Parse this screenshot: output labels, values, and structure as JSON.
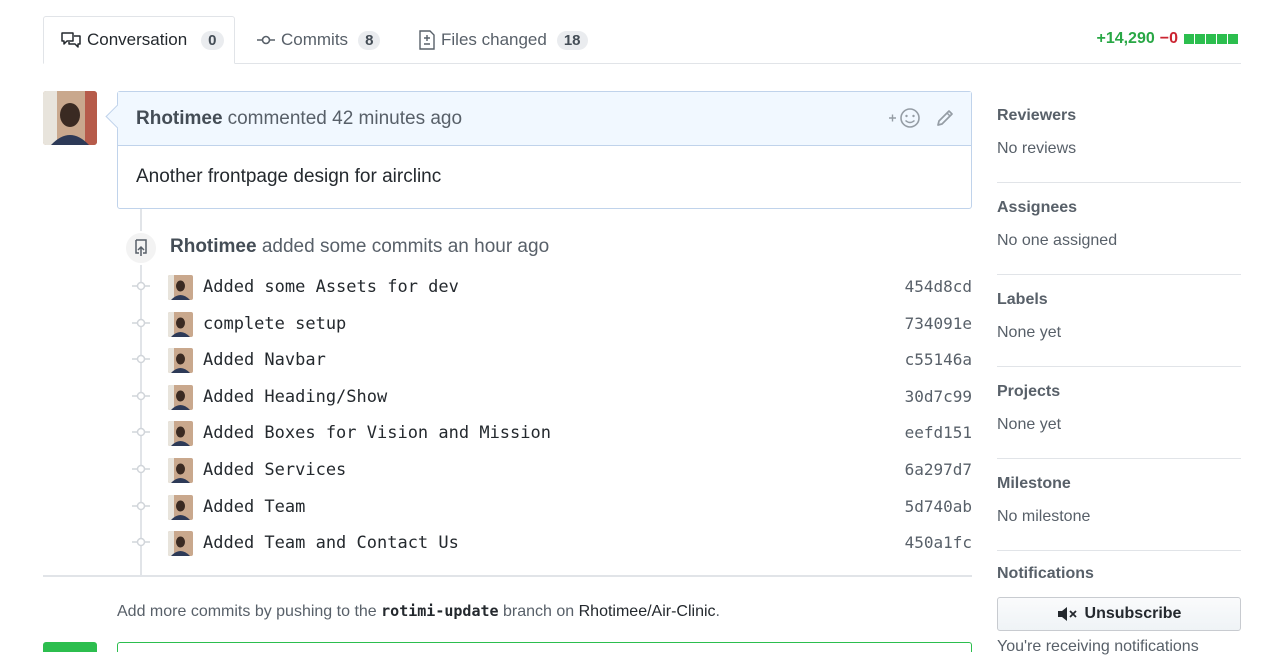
{
  "tabs": [
    {
      "label": "Conversation",
      "count": "0",
      "icon": "comment-discussion-icon"
    },
    {
      "label": "Commits",
      "count": "8",
      "icon": "git-commit-icon"
    },
    {
      "label": "Files changed",
      "count": "18",
      "icon": "file-diff-icon"
    }
  ],
  "diffstat": {
    "additions": "+14,290",
    "deletions": "−0",
    "blocks_added": 5,
    "blocks_total": 5
  },
  "comment": {
    "author": "Rhotimee",
    "action": "commented 42 minutes ago",
    "body": "Another frontpage design for airclinc"
  },
  "commit_event": {
    "author": "Rhotimee",
    "action": "added some commits an hour ago"
  },
  "commits": [
    {
      "message": "Added some Assets for dev",
      "sha": "454d8cd"
    },
    {
      "message": "complete setup",
      "sha": "734091e"
    },
    {
      "message": "Added Navbar",
      "sha": "c55146a"
    },
    {
      "message": "Added Heading/Show",
      "sha": "30d7c99"
    },
    {
      "message": "Added Boxes for Vision and Mission",
      "sha": "eefd151"
    },
    {
      "message": "Added Services",
      "sha": "6a297d7"
    },
    {
      "message": "Added Team",
      "sha": "5d740ab"
    },
    {
      "message": "Added Team and Contact Us",
      "sha": "450a1fc"
    }
  ],
  "push_hint": {
    "prefix": "Add more commits by pushing to the",
    "branch": "rotimi-update",
    "middle": "branch on",
    "repo": "Rhotimee/Air-Clinic",
    "suffix": "."
  },
  "sidebar": {
    "sections": [
      {
        "heading": "Reviewers",
        "value": "No reviews"
      },
      {
        "heading": "Assignees",
        "value": "No one assigned"
      },
      {
        "heading": "Labels",
        "value": "None yet"
      },
      {
        "heading": "Projects",
        "value": "None yet"
      },
      {
        "heading": "Milestone",
        "value": "No milestone"
      }
    ],
    "notifications": {
      "heading": "Notifications",
      "button_label": "Unsubscribe",
      "note": "You're receiving notifications"
    }
  },
  "colors": {
    "addition": "#28a745",
    "deletion": "#cb2431",
    "comment_header_bg": "#f1f8ff",
    "comment_border": "#c0d3eb"
  }
}
